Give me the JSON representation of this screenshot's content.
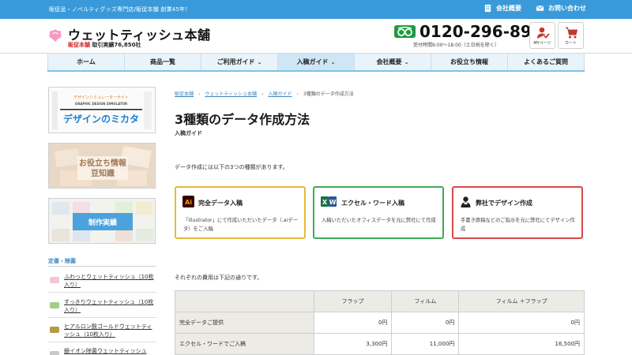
{
  "topbar": {
    "tagline": "販促品・ノベルティグッズ専門店/販促本舗 創業45年！",
    "company_link": "会社概要",
    "contact_link": "お問い合わせ"
  },
  "header": {
    "logo_title": "ウェットティッシュ本舗",
    "logo_sub_brand": "販促本舗",
    "logo_sub_record": "取引実績76,850社",
    "tel_number": "0120-296-890",
    "tel_hours": "受付時間9:00〜18:00（土日祝を除く）",
    "mypage_label": "MYページ",
    "cart_label": "カート"
  },
  "nav": [
    {
      "label": "ホーム",
      "dropdown": false
    },
    {
      "label": "商品一覧",
      "dropdown": false
    },
    {
      "label": "ご利用ガイド",
      "dropdown": true
    },
    {
      "label": "入稿ガイド",
      "dropdown": true
    },
    {
      "label": "会社概要",
      "dropdown": true
    },
    {
      "label": "お役立ち情報",
      "dropdown": false
    },
    {
      "label": "よくあるご質問",
      "dropdown": false
    }
  ],
  "banners": {
    "design": {
      "small": "デザインシミュレーターサイト",
      "en": "GRAPHIC DESIGN SIMULATOR",
      "big": "デザインのミカタ"
    },
    "tips": {
      "line1": "お役立ち情報",
      "line2": "豆知識"
    },
    "works": {
      "label": "制作実績"
    }
  },
  "sidebar": {
    "heading": "定番・除菌",
    "items": [
      {
        "label": "ふわっとウェットティッシュ（10枚入り）"
      },
      {
        "label": "すっきりウェットティッシュ（10枚入り）"
      },
      {
        "label": "ヒアルロン酸ゴールドウェットティッシュ（10枚入り）"
      },
      {
        "label": "銀イオン除菌ウェットティッシュ"
      }
    ]
  },
  "breadcrumb": [
    "販促本舗",
    "ウェットティッシュ本舗",
    "入稿ガイド",
    "3種類のデータ作成方法"
  ],
  "page": {
    "title": "3種類のデータ作成方法",
    "category": "入稿ガイド",
    "intro": "データ作成には以下の3つの種類があります。",
    "fee_intro": "それぞれの費用は下記の通りです。"
  },
  "cards": [
    {
      "title": "完全データ入稿",
      "desc": "「illustrator」にて作成いただいたデータ（.aiデータ）をご入稿",
      "icon": "illustrator-icon",
      "border": "#e7b83e"
    },
    {
      "title": "エクセル・ワード入稿",
      "desc": "入稿いただいたオフィスデータを元に弊社にて作成",
      "icon": "office-icon",
      "border": "#3fab58"
    },
    {
      "title": "弊社でデザイン作成",
      "desc": "手書き原稿などのご指示を元に弊社にてデザイン作成",
      "icon": "designer-icon",
      "border": "#d94848"
    }
  ],
  "fee_table": {
    "headers": [
      "",
      "フラップ",
      "フィルム",
      "フィルム ＋フラップ"
    ],
    "rows": [
      {
        "label": "完全データご提供",
        "cells": [
          "0円",
          "0円",
          "0円"
        ]
      },
      {
        "label": "エクセル・ワードでご入稿",
        "cells": [
          "3,300円",
          "11,000円",
          "16,500円"
        ]
      }
    ]
  },
  "colors": {
    "topbar": "#3a9ad9",
    "nav_bg": "#e8f3fb",
    "accent_blue": "#3a84bf",
    "brand_red": "#d42626",
    "tel_green": "#1e9b3f"
  }
}
